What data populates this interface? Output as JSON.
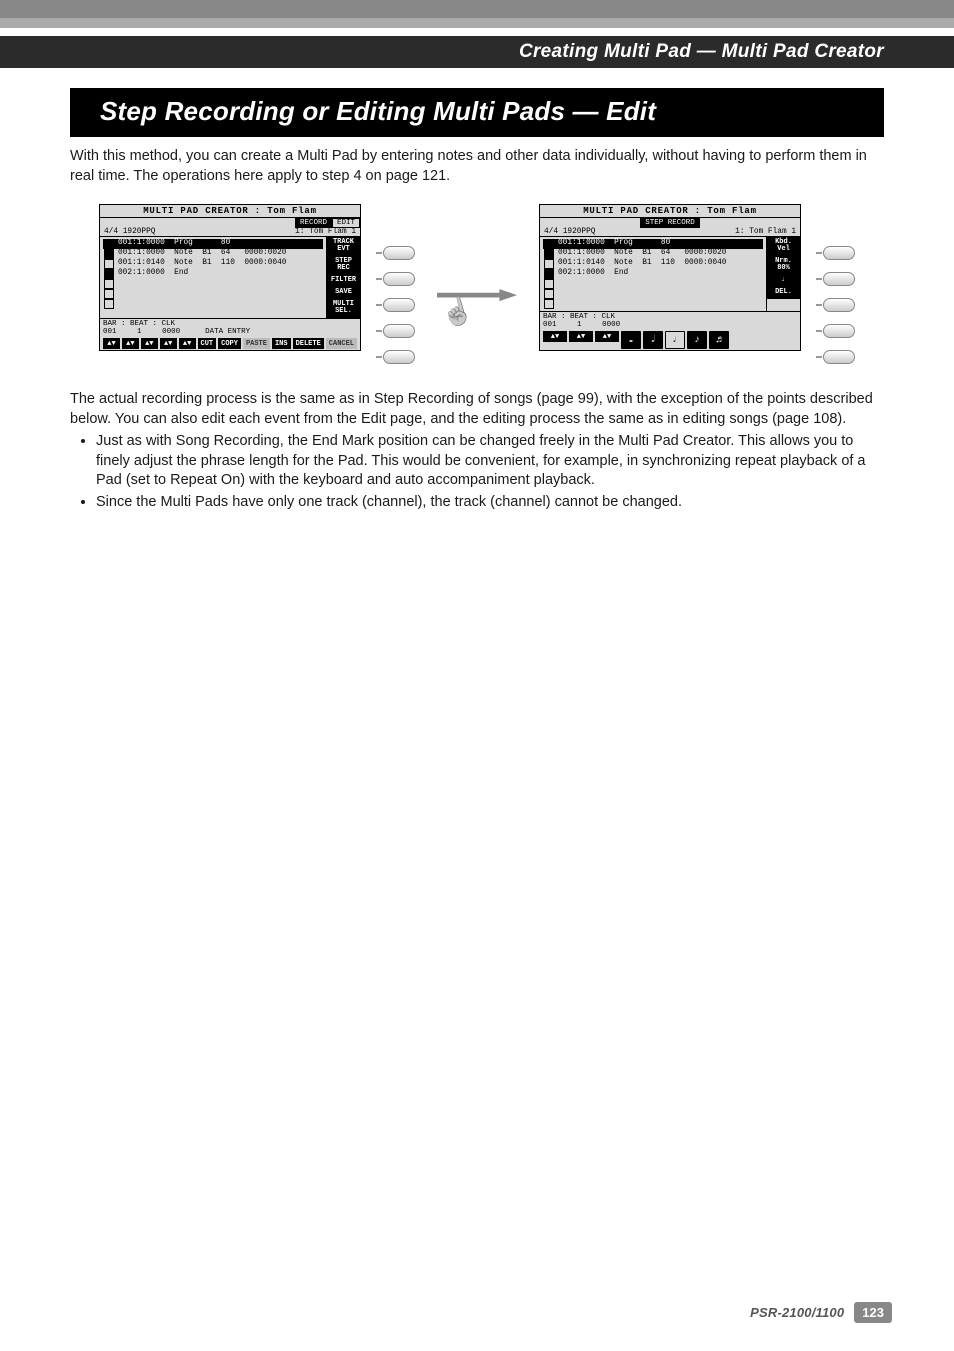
{
  "chapter_title": "Creating Multi Pad — Multi Pad Creator",
  "heading": "Step Recording or Editing Multi Pads — Edit",
  "intro": "With this method, you can create a Multi Pad by entering notes and other data individually, without having to perform them in real time. The operations here apply to step 4 on page 121.",
  "lcd": {
    "title": "MULTI PAD CREATOR : Tom Flam",
    "tabs": {
      "left": "RECORD",
      "right": "EDIT",
      "step": "STEP RECORD"
    },
    "header": {
      "left": "4/4    1920PPQ",
      "right": "1: Tom Flam 1"
    },
    "events": [
      {
        "sel": true,
        "pos": "001:1:0000",
        "type": "Prog",
        "c1": "",
        "c2": "80",
        "c3": ""
      },
      {
        "sel": false,
        "pos": "001:1:0000",
        "type": "Note",
        "c1": "B1",
        "c2": "64",
        "c3": "0000:0020"
      },
      {
        "sel": false,
        "pos": "001:1:0140",
        "type": "Note",
        "c1": "B1",
        "c2": "110",
        "c3": "0000:0040"
      },
      {
        "sel": false,
        "pos": "002:1:0000",
        "type": "End",
        "c1": "",
        "c2": "",
        "c3": ""
      }
    ],
    "side_left": [
      "TRACK EVT",
      "STEP REC",
      "FILTER",
      "SAVE",
      "MULTI SEL."
    ],
    "side_right": [
      "Kbd. Vel",
      "Nrm. 80%",
      "♩",
      "DEL."
    ],
    "foot": {
      "group_label": "BAR : BEAT : CLK",
      "bar": "001",
      "beat": "1",
      "clk": "0000",
      "data_entry_label": "DATA ENTRY",
      "btns_left": [
        "CUT",
        "COPY",
        "PASTE",
        "INS",
        "DELETE",
        "CANCEL"
      ],
      "notes": [
        "𝅝",
        "𝅗𝅥",
        "♩",
        "♪",
        "♬"
      ]
    }
  },
  "body_para": "The actual recording process is the same as in Step Recording of songs (page 99), with the exception of the points described below. You can also edit each event from the Edit page, and the editing process the same as in editing songs (page 108).",
  "bullets": [
    "Just as with Song Recording, the End Mark position can be changed freely in the Multi Pad Creator. This allows you to finely adjust the phrase length for the Pad. This would be convenient, for example, in synchronizing repeat playback of a Pad (set to Repeat On) with the keyboard and auto accompaniment playback.",
    "Since the Multi Pads have only one track (channel), the track (channel) cannot be changed."
  ],
  "footer": {
    "model": "PSR-2100/1100",
    "page": "123"
  }
}
